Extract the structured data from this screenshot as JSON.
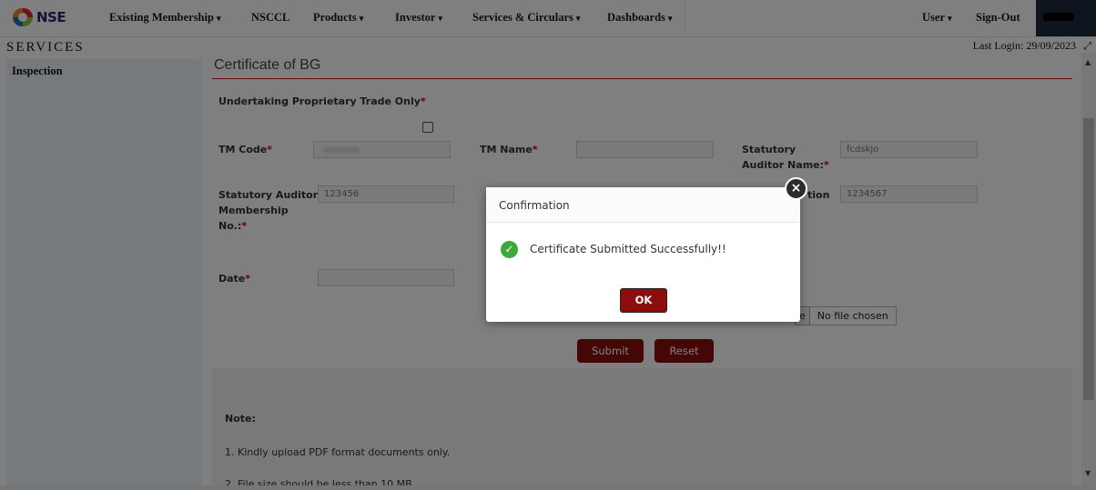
{
  "brand": {
    "name": "NSE",
    "colors": [
      "#f58220",
      "#e4262f",
      "#1f73b7",
      "#8dc63f"
    ]
  },
  "nav": {
    "items": [
      {
        "label": "Existing Membership",
        "dropdown": true
      },
      {
        "label": "NSCCL",
        "dropdown": false
      },
      {
        "label": "Products",
        "dropdown": true
      },
      {
        "label": "Investor",
        "dropdown": true
      },
      {
        "label": "Services & Circulars",
        "dropdown": true
      },
      {
        "label": "Dashboards",
        "dropdown": true
      }
    ],
    "user_label": "User",
    "signout_label": "Sign-Out",
    "caret": "▾"
  },
  "header": {
    "section_title": "SERVICES",
    "last_login": "Last Login: 29/09/2023"
  },
  "sidebar": {
    "items": [
      {
        "label": "Inspection"
      }
    ]
  },
  "form": {
    "title": "Certificate of BG",
    "undertaking_label": "Undertaking Proprietary Trade Only",
    "tm_code_label": "TM Code",
    "tm_name_label": "TM Name",
    "auditor_name_label": "Statutory Auditor Name:",
    "auditor_name_value": "fcdskjo",
    "membership_label": "Statutory Auditor Membership No.:",
    "membership_value": "123456",
    "partial_label_b": "tion",
    "partial_value_b": "1234567",
    "date_label": "Date",
    "file_button_partial": "e",
    "file_status": "No file chosen",
    "required_mark": "*",
    "submit_label": "Submit",
    "reset_label": "Reset"
  },
  "notes": {
    "heading": "Note:",
    "items": [
      "1. Kindly upload PDF format documents only.",
      "2. File size should be less than 10 MB"
    ]
  },
  "modal": {
    "title": "Confirmation",
    "message": "Certificate Submitted Successfully!!",
    "ok_label": "OK",
    "close_glyph": "×",
    "success_glyph": "✓",
    "success_color": "#3aa83a"
  },
  "accent_color": "#8b0d0d"
}
